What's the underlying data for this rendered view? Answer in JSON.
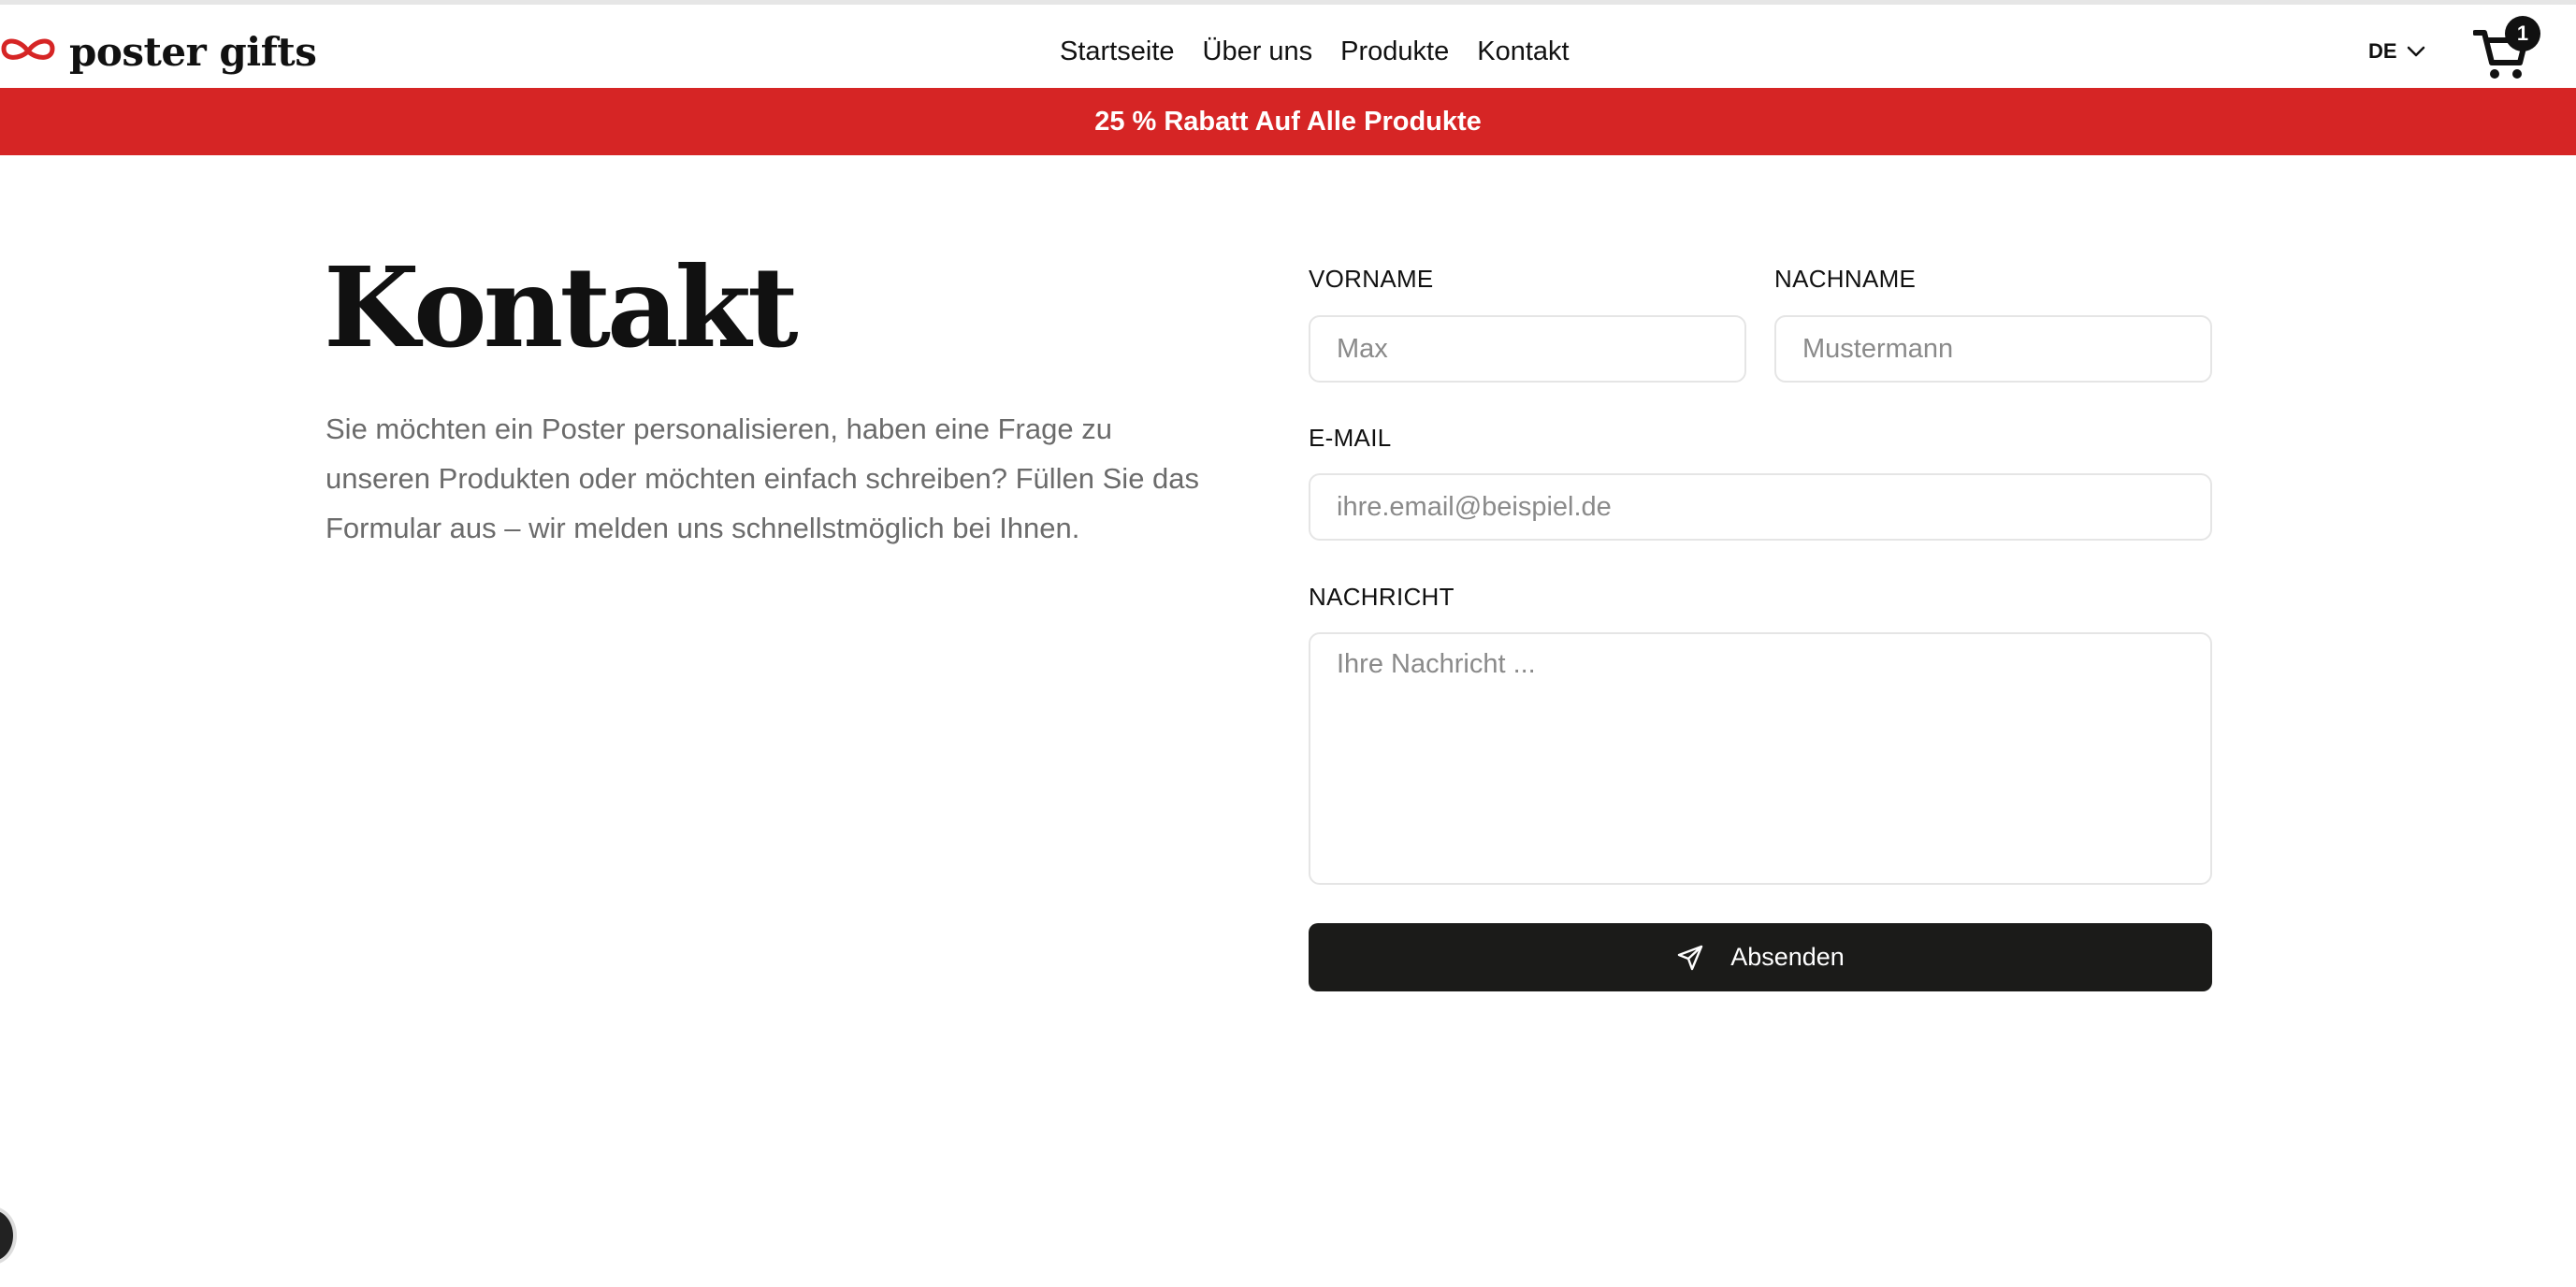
{
  "header": {
    "logo_text": "poster gifts",
    "nav": [
      {
        "label": "Startseite"
      },
      {
        "label": "Über uns"
      },
      {
        "label": "Produkte"
      },
      {
        "label": "Kontakt"
      }
    ],
    "language": "DE",
    "cart_count": "1"
  },
  "promo": {
    "text": "25 % Rabatt Auf Alle Produkte"
  },
  "contact": {
    "title": "Kontakt",
    "intro": "Sie möchten ein Poster personalisieren, haben eine Frage zu unseren Produkten oder möchten einfach schreiben? Füllen Sie das Formular aus – wir melden uns schnellstmöglich bei Ihnen."
  },
  "form": {
    "first_name": {
      "label": "VORNAME",
      "placeholder": "Max",
      "value": ""
    },
    "last_name": {
      "label": "NACHNAME",
      "placeholder": "Mustermann",
      "value": ""
    },
    "email": {
      "label": "E-MAIL",
      "placeholder": "ihre.email@beispiel.de",
      "value": ""
    },
    "message": {
      "label": "NACHRICHT",
      "placeholder": "Ihre Nachricht ...",
      "value": ""
    },
    "submit_label": "Absenden"
  },
  "colors": {
    "promo_bg": "#d62525",
    "button_bg": "#1b1b19",
    "logo_accent": "#d62525"
  },
  "icons": {
    "logo": "ribbon-bow-icon",
    "language": "chevron-down-icon",
    "cart": "shopping-cart-icon",
    "submit": "send-icon"
  }
}
